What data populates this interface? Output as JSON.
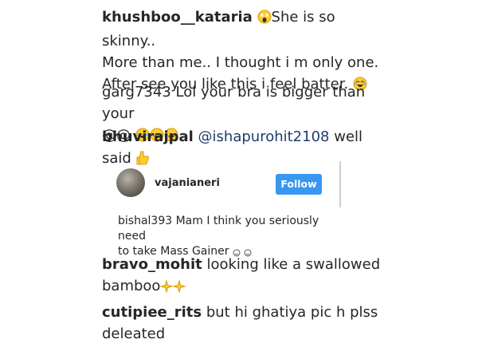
{
  "comments": [
    {
      "user": "khushboo__kataria",
      "text1": "She is so skinny..",
      "text2": "More than me.. I thought i m only one.",
      "text3": "After see you like this i feel batter.",
      "emoji1": "scream-emoji",
      "emoji2": "laugh-cry-emoji"
    },
    {
      "user": "garg7343",
      "text1": "Lol your bra is bigger than your",
      "text2": "@@",
      "emoji1": "laugh-cry-emoji"
    },
    {
      "user": "bhuvirajpal",
      "mention": "@ishapurohit2108",
      "text1": "well said",
      "emoji1": "thumbs-up-emoji"
    },
    {
      "user": "bravo_mohit",
      "text1": "looking like a swallowed",
      "text2": "bamboo",
      "emoji1": "sparkle-emoji"
    },
    {
      "user": "cutipiee_rits",
      "text1": "but hi ghatiya pic h plss",
      "text2": "deleated"
    }
  ],
  "card": {
    "username": "vajanianeri",
    "follow_label": "Follow",
    "comment_user": "bishal393",
    "comment_text1": "Mam I think you seriously need",
    "comment_text2": "to take Mass Gainer",
    "emoji1": "smile-emoji"
  },
  "colors": {
    "follow_button": "#3897f0",
    "mention": "#1f3c6b"
  }
}
